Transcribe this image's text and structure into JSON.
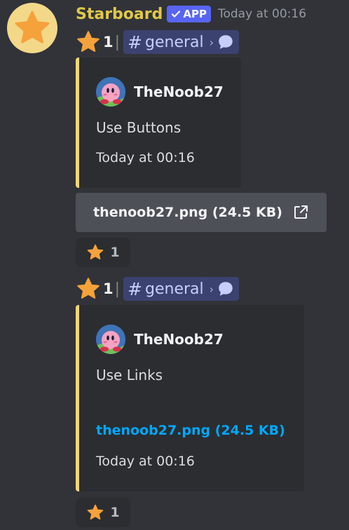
{
  "message": {
    "author": "Starboard",
    "badge": "APP",
    "timestamp": "Today at 00:16",
    "avatar_icon": "star-icon"
  },
  "entries": [
    {
      "star_count": "1",
      "channel": "general",
      "embed": {
        "author": "TheNoob27",
        "text": "Use Buttons",
        "time": "Today at 00:16"
      },
      "button_label": "thenoob27.png (24.5 KB)",
      "reaction_count": "1"
    },
    {
      "star_count": "1",
      "channel": "general",
      "embed": {
        "author": "TheNoob27",
        "text": "Use Links",
        "link": "thenoob27.png (24.5 KB)",
        "time": "Today at 00:16"
      },
      "reaction_count": "1"
    }
  ],
  "colors": {
    "background": "#313338",
    "embed_border": "#f0d779",
    "channel_pill": "#3c4270",
    "link": "#00a8fc",
    "badge": "#5865f2"
  }
}
